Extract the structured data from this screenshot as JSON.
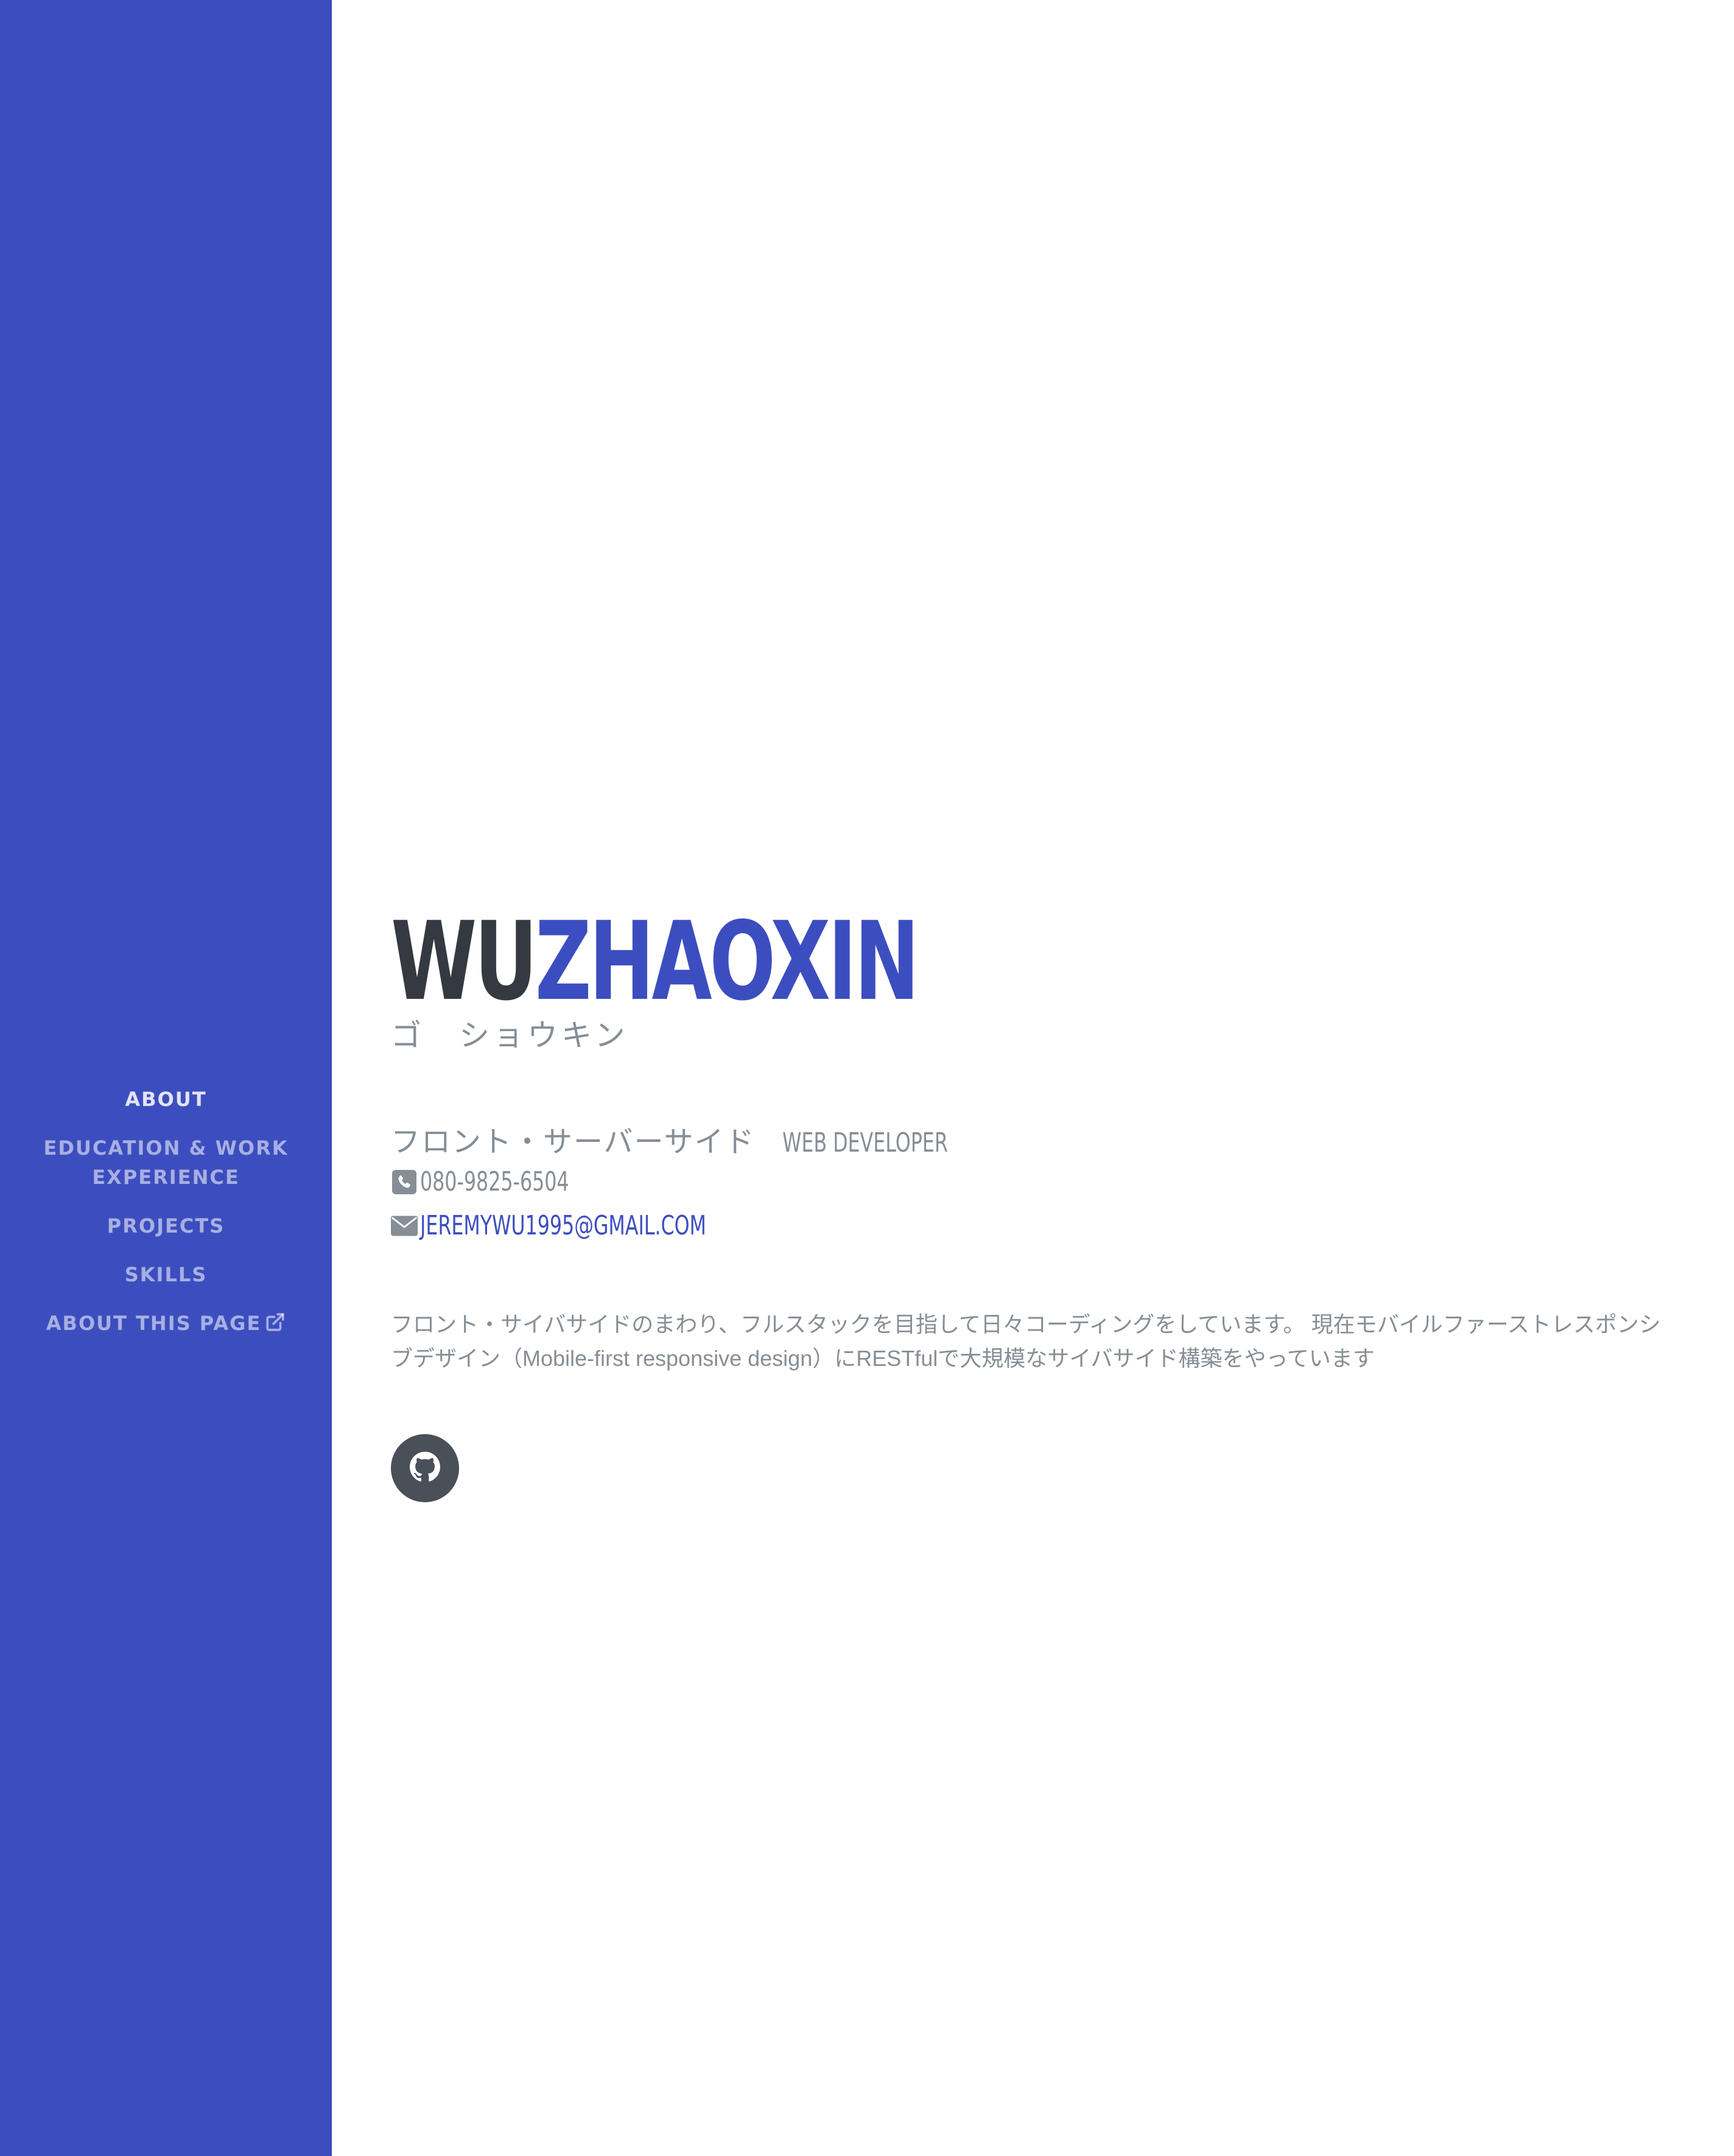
{
  "sidebar": {
    "background": "#3c4ebf",
    "nav": [
      {
        "label": "About",
        "active": true
      },
      {
        "label": "Education & Work",
        "label2": "Experience"
      },
      {
        "label": "Projects"
      },
      {
        "label": "Skills"
      },
      {
        "label": "About this page",
        "icon": "external-link-icon"
      }
    ]
  },
  "profile": {
    "first_name": "WU",
    "last_name": "ZHAOXIN",
    "kana": "ゴ　ショウキン",
    "role_jp": "フロント・サーバーサイド",
    "role_en": "WEB DEVELOPER",
    "phone_icon": "phone-icon",
    "phone": "080-9825-6504",
    "email_icon": "envelope-icon",
    "email": "jeremywu1995@gmail.com",
    "lead": "フロント・サイバサイドのまわり、フルスタックを目指して日々コーディングをしています。 現在モバイルファーストレスポンシブデザイン（Mobile-first responsive design）にRESTfulで大規模なサイバサイド構築をやっています",
    "social": [
      {
        "icon": "github-icon"
      }
    ]
  },
  "colors": {
    "primary": "#3c4ebf",
    "dark": "#343a40",
    "muted": "#868e96",
    "social_bg": "#495057"
  }
}
